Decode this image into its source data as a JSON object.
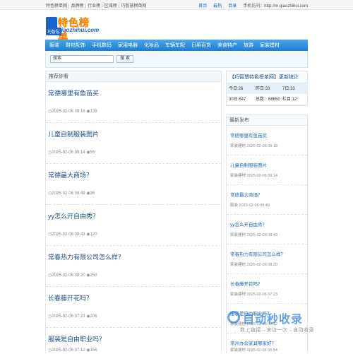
{
  "topbar": {
    "left": [
      "特色榜单网",
      "品牌榜",
      "行业榜",
      "区域榜",
      "巧智慧榜单网"
    ],
    "right": [
      "首页",
      "最热",
      "目录",
      "手机访问：http://m.qiaozhihui.com"
    ]
  },
  "logo": {
    "cn": "特色榜单",
    "tag": "巧智慧",
    "en": "qiaozhihui.com"
  },
  "nav": [
    "服装",
    "鞋包配饰",
    "手机数码",
    "家用电器",
    "化妆品",
    "车辆车配",
    "日用百货",
    "美食特产",
    "旅游",
    "家装建材"
  ],
  "search": {
    "placeholder": "搜索",
    "button": "搜 索"
  },
  "main": {
    "heading": "推荐你看",
    "articles": [
      {
        "title": "常德哪里有鱼苗买",
        "date": "2025-02-06 09:18",
        "views": "139"
      },
      {
        "title": "儿童自制服装图片",
        "date": "2025-02-06 09:14",
        "views": "55"
      },
      {
        "title": "常德最大商场？",
        "date": "2025-02-06 08:49",
        "views": "96"
      },
      {
        "title": "yy怎么开自由秀？",
        "date": "2025-02-06 08:43",
        "views": "120"
      },
      {
        "title": "常春热力有限公司怎么样？",
        "date": "2025-02-06 08:20",
        "views": "250"
      },
      {
        "title": "长春藤开花吗？",
        "date": "2025-02-06 07:23",
        "views": "206"
      },
      {
        "title": "服装是自由职业吗？",
        "date": "2025-02-06 07:12",
        "views": "155"
      }
    ]
  },
  "stats": {
    "title": "【巧智慧特色榜单网】更新统计",
    "rows": [
      [
        "今日:26",
        "昨日:33",
        "7日:33"
      ],
      [
        "30日:647",
        "总数：68650",
        "栏目:12"
      ]
    ]
  },
  "latest": {
    "heading": "最新发布",
    "items": [
      {
        "title": "常德哪里有鱼苗买",
        "meta": "家装建材 2025-02-06 09:18"
      },
      {
        "title": "儿童自制服装图片",
        "meta": "家装建材 2025-02-06 09:14"
      },
      {
        "title": "常德最大商场？",
        "meta": "服装 2025-02-06 08:49"
      },
      {
        "title": "yy怎么开自由秀？",
        "meta": "家装建材 2025-02-06 08:43"
      },
      {
        "title": "常春热力有限公司怎么样？",
        "meta": "家装建材 2025-02-06 08:20"
      },
      {
        "title": "长春藤开花吗？",
        "meta": "家装建材 2025-02-06 07:23"
      },
      {
        "title": "服装是自由职业吗？",
        "meta": "家装建材 2025-02-06 07:12"
      },
      {
        "title": "常州办公家具哪家好？",
        "meta": "家装建材 2025-02-06 06:54"
      }
    ]
  },
  "watermark": {
    "main": "自动秒收录",
    "sub": "数上链接→来访一次→自动收录"
  }
}
